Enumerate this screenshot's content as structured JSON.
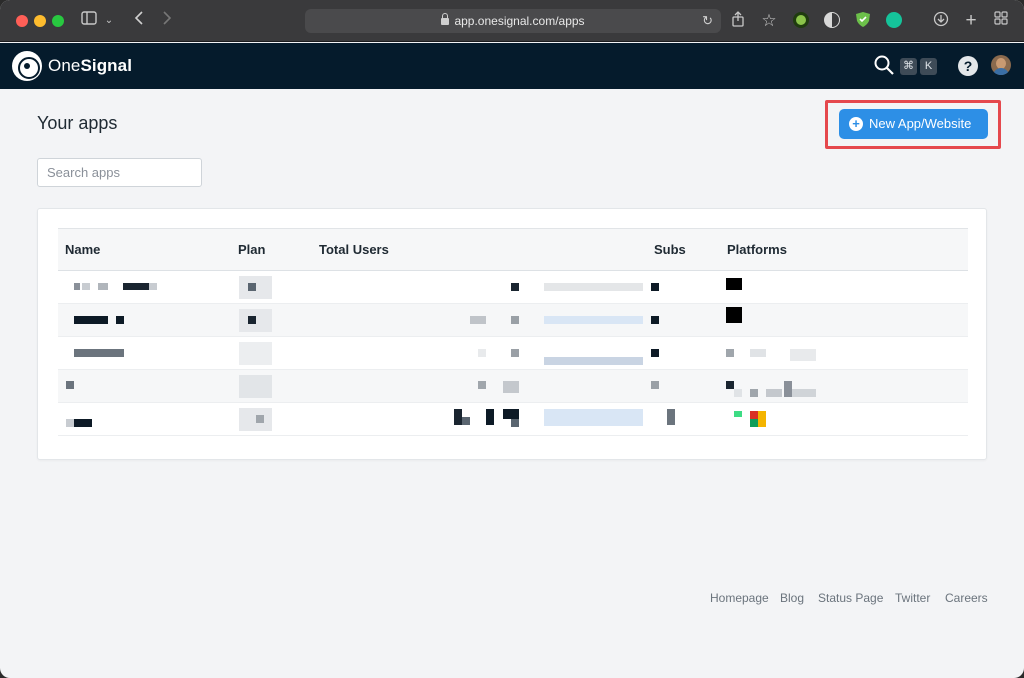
{
  "browser": {
    "url": "app.onesignal.com/apps"
  },
  "header": {
    "brand_light": "One",
    "brand_bold": "Signal",
    "shortcut_keys": [
      "⌘",
      "K"
    ],
    "help": "?"
  },
  "main": {
    "title": "Your apps",
    "new_app_button": "New App/Website",
    "search_placeholder": "Search apps",
    "table": {
      "columns": [
        "Name",
        "Plan",
        "Total Users",
        "Subs",
        "Platforms"
      ],
      "row_count": 5
    }
  },
  "footer": {
    "links": [
      "Homepage",
      "Blog",
      "Status Page",
      "Twitter",
      "Careers"
    ]
  },
  "colors": {
    "header_bg": "#051b2c",
    "primary": "#2d8fe6",
    "highlight": "#e5484d"
  }
}
